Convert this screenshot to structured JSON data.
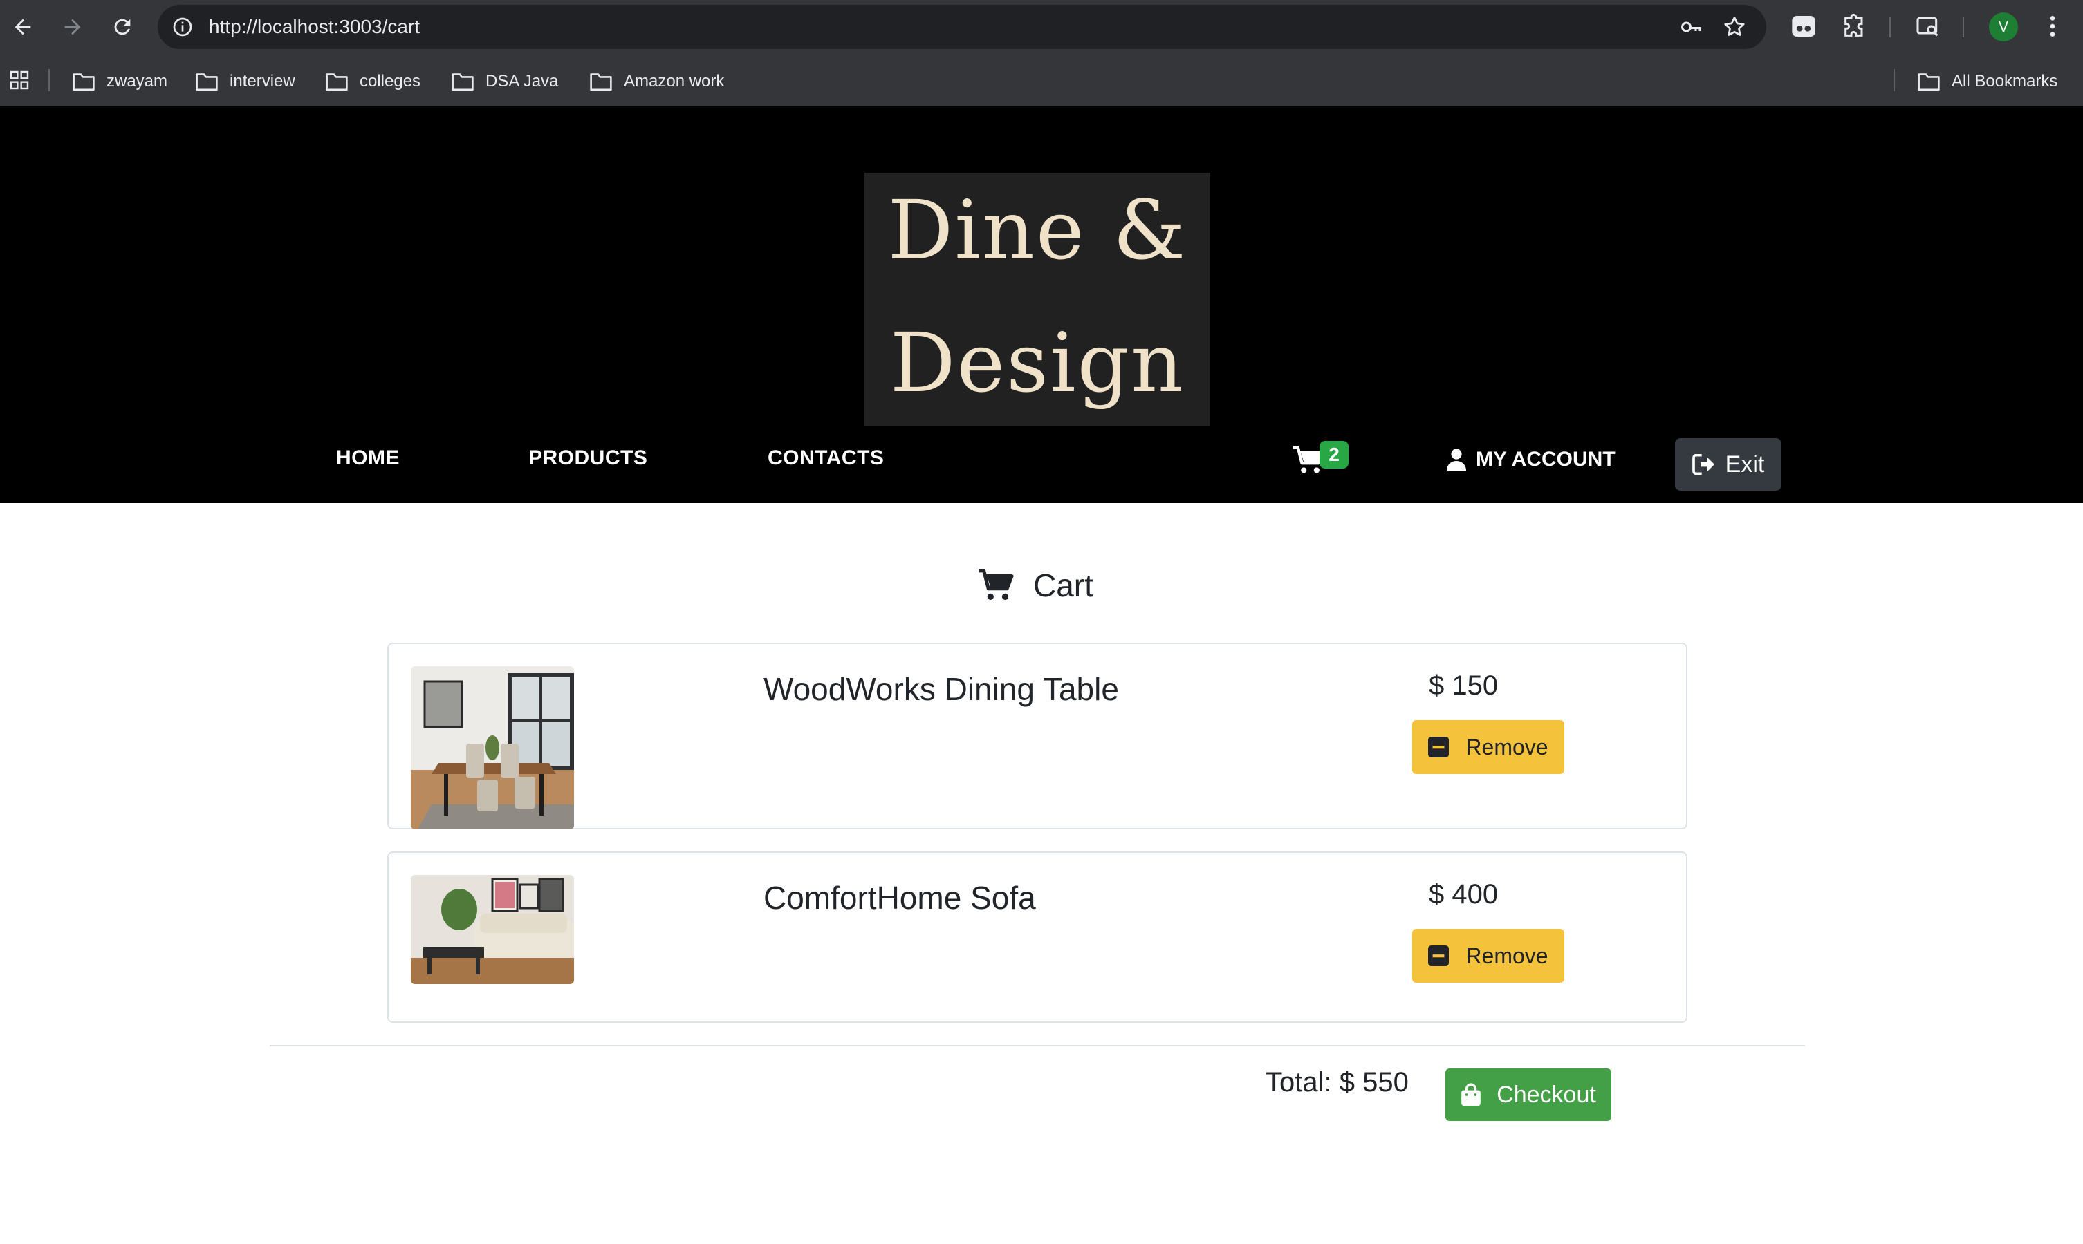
{
  "browser": {
    "url": "http://localhost:3003/cart",
    "profile_initial": "V",
    "bookmarks": [
      "zwayam",
      "interview",
      "colleges",
      "DSA Java",
      "Amazon work"
    ],
    "all_bookmarks_label": "All Bookmarks",
    "theme": {
      "chrome_bg": "#35363a",
      "omnibox_bg": "#202124",
      "text": "#e8eaed"
    }
  },
  "site": {
    "logo": {
      "line1": "Dine &",
      "line2": "Design"
    },
    "nav": {
      "home": "HOME",
      "products": "PRODUCTS",
      "contacts": "CONTACTS"
    },
    "cart_count": "2",
    "account_label": "MY ACCOUNT",
    "exit_label": "Exit"
  },
  "cart": {
    "title": "Cart",
    "items": [
      {
        "name": "WoodWorks Dining Table",
        "price": "$ 150",
        "remove_label": "Remove",
        "image": "dining-table-photo"
      },
      {
        "name": "ComfortHome Sofa",
        "price": "$ 400",
        "remove_label": "Remove",
        "image": "sofa-photo"
      }
    ],
    "total": "Total: $ 550",
    "checkout_label": "Checkout"
  },
  "colors": {
    "header_bg": "#000000",
    "logo_bg": "#212121",
    "logo_text": "#efe2c9",
    "remove_button": "#f5c33b",
    "checkout_button": "#43a047",
    "badge": "#28a745",
    "exit_button": "#343a40"
  }
}
